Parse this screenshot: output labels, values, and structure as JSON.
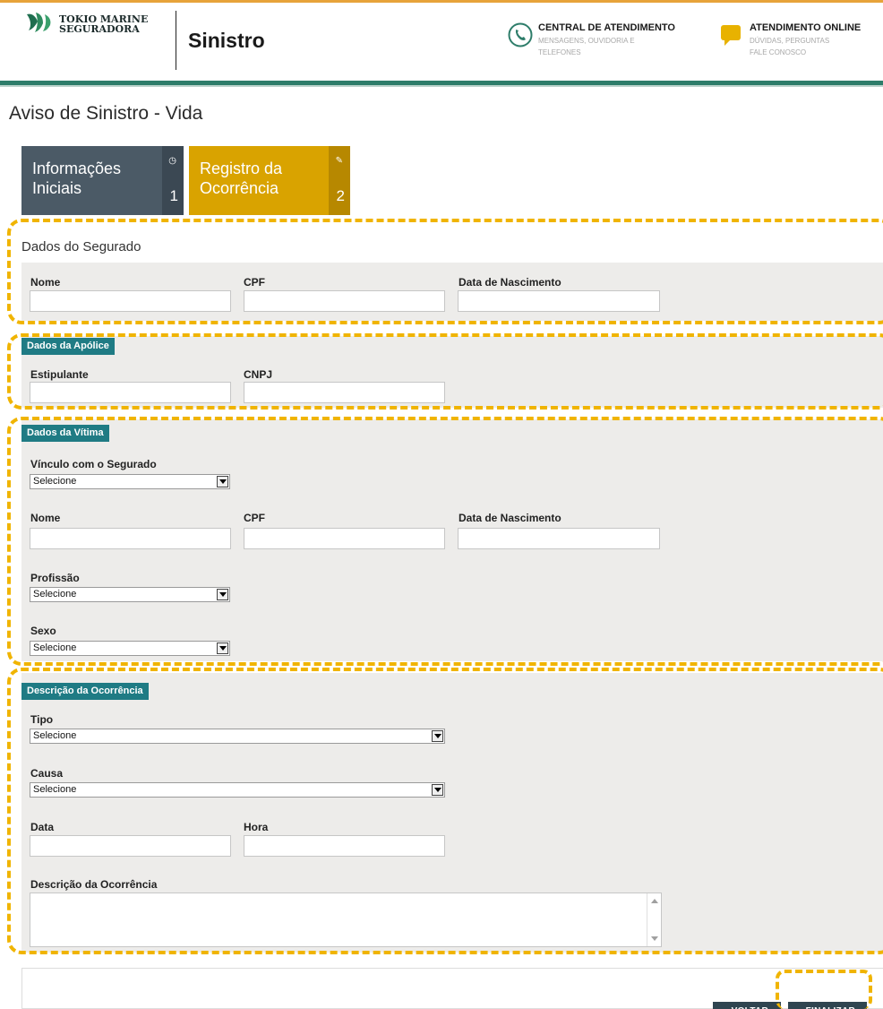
{
  "brand": {
    "line1": "TOKIO MARINE",
    "line2": "SEGURADORA"
  },
  "header": {
    "title": "Sinistro"
  },
  "contacts": [
    {
      "title": "CENTRAL DE ATENDIMENTO",
      "line1": "MENSAGENS, OUVIDORIA E",
      "line2": "TELEFONES"
    },
    {
      "title": "ATENDIMENTO ONLINE",
      "line1": "DÚVIDAS, PERGUNTAS",
      "line2": "FALE CONOSCO"
    }
  ],
  "page_title": "Aviso de Sinistro - Vida",
  "steps": [
    {
      "line1": "Informações",
      "line2": "Iniciais",
      "num": "1",
      "icon": "clock-icon"
    },
    {
      "line1": "Registro da",
      "line2": "Ocorrência",
      "num": "2",
      "icon": "pencil-icon"
    }
  ],
  "segurado": {
    "title": "Dados do Segurado",
    "nome": "Nome",
    "cpf": "CPF",
    "nascimento": "Data de Nascimento"
  },
  "apolice": {
    "title": "Dados da Apólice",
    "estipulante": "Estipulante",
    "cnpj": "CNPJ"
  },
  "vitima": {
    "title": "Dados da Vítima",
    "vinculo": "Vínculo com o Segurado",
    "vinculo_value": "Selecione",
    "nome": "Nome",
    "cpf": "CPF",
    "nascimento": "Data de Nascimento",
    "profissao": "Profissão",
    "profissao_value": "Selecione",
    "sexo": "Sexo",
    "sexo_value": "Selecione"
  },
  "ocorrencia": {
    "title": "Descrição da Ocorrência",
    "tipo": "Tipo",
    "tipo_value": "Selecione",
    "causa": "Causa",
    "causa_value": "Selecione",
    "data": "Data",
    "hora": "Hora",
    "descricao": "Descrição da Ocorrência"
  },
  "buttons": {
    "voltar": "‹ VOLTAR",
    "finalizar": "› FINALIZAR"
  },
  "colors": {
    "accent": "#f0b400",
    "teal": "#1f7b84",
    "step1": "#4b5a66",
    "step2": "#d9a300",
    "header_bar": "#2e7d6a"
  }
}
